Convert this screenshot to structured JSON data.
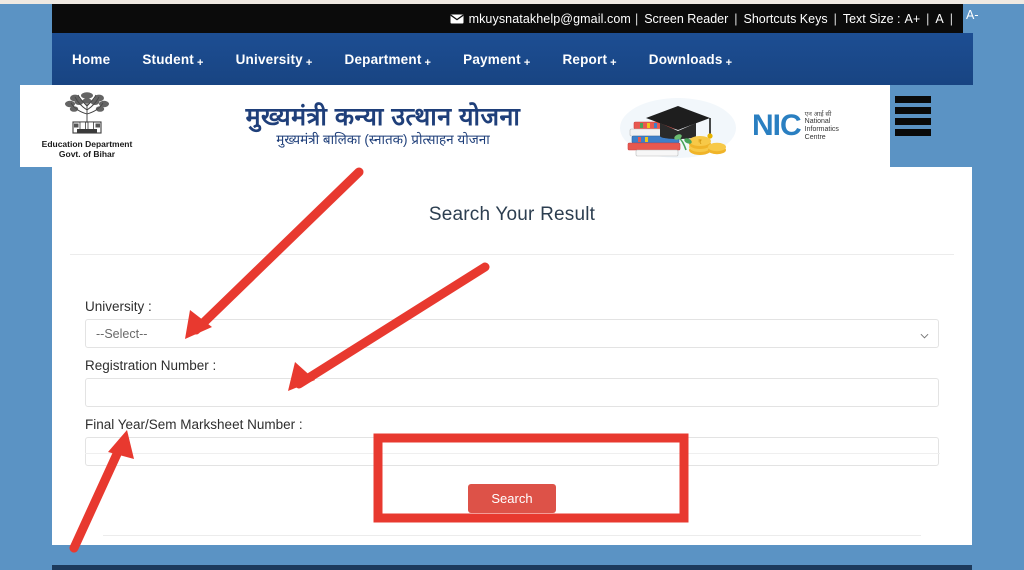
{
  "utility_bar": {
    "mail_icon": "envelope-icon",
    "email": "mkuysnatakhelp@gmail.com",
    "sep1": "|",
    "screen_reader": "Screen Reader",
    "sep2": "|",
    "shortcuts": "Shortcuts Keys",
    "sep3": "|",
    "text_size_label": "Text Size :",
    "size_large": "A+",
    "sep4": "|",
    "size_normal": "A",
    "sep5": "|",
    "size_small": "A-"
  },
  "nav": {
    "items": [
      {
        "label": "Home",
        "has_dropdown": false,
        "plus": ""
      },
      {
        "label": "Student",
        "has_dropdown": true,
        "plus": "+"
      },
      {
        "label": "University",
        "has_dropdown": true,
        "plus": "+"
      },
      {
        "label": "Department",
        "has_dropdown": true,
        "plus": "+"
      },
      {
        "label": "Payment",
        "has_dropdown": true,
        "plus": "+"
      },
      {
        "label": "Report",
        "has_dropdown": true,
        "plus": "+"
      },
      {
        "label": "Downloads",
        "has_dropdown": true,
        "plus": "+"
      }
    ]
  },
  "header": {
    "emblem_icon": "bihar-education-emblem-icon",
    "emblem_line1": "Education Department",
    "emblem_line2": "Govt. of Bihar",
    "title_hindi": "मुख्यमंत्री कन्या उत्थान योजना",
    "subtitle_hindi": "मुख्यमंत्री बालिका (स्नातक) प्रोत्साहन योजना",
    "books_icon": "books-graduation-cap-icon",
    "nic_mark": "NIC",
    "nic_hindi": "एन आई सी",
    "nic_line1": "National",
    "nic_line2": "Informatics",
    "nic_line3": "Centre",
    "menu_icon": "hamburger-menu-icon"
  },
  "main": {
    "page_title": "Search Your Result",
    "fields": [
      {
        "label": "University :",
        "type": "select",
        "value": "--Select--",
        "placeholder": "--Select--",
        "chevron_icon": "chevron-down-icon"
      },
      {
        "label": "Registration Number :",
        "type": "text",
        "value": "",
        "placeholder": ""
      },
      {
        "label": "Final Year/Sem Marksheet Number :",
        "type": "text",
        "value": "",
        "placeholder": ""
      }
    ],
    "search_button": "Search"
  },
  "colors": {
    "page_background": "#5b93c4",
    "navbar": "#1b4b8f",
    "utility_bar": "#0b0b0b",
    "title_blue": "#1f3f7a",
    "button_red": "#dd5248",
    "annotation_red": "#e8392f",
    "nic_blue": "#2a7fc1"
  },
  "annotations": {
    "arrow_1_target": "university-select",
    "arrow_2_target": "registration-number-input",
    "arrow_3_target": "marksheet-number-input",
    "highlight_box_target": "search-button"
  }
}
